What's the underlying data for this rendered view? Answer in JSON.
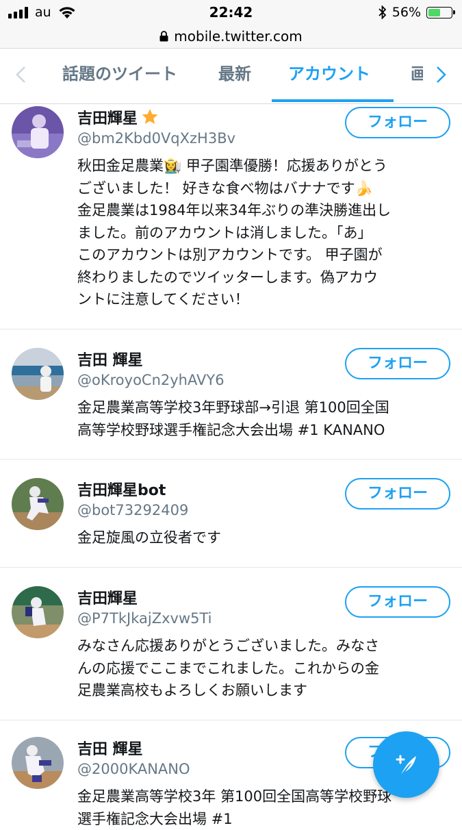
{
  "status_bar": {
    "carrier": "au",
    "time": "22:42",
    "battery_percent": "56%",
    "battery_level": 0.56
  },
  "address_bar": {
    "url": "mobile.twitter.com"
  },
  "tabs": {
    "items": [
      {
        "label": "話題のツイート"
      },
      {
        "label": "最新"
      },
      {
        "label": "アカウント",
        "active": true
      },
      {
        "label": "画像"
      }
    ]
  },
  "accounts": [
    {
      "name": "吉田輝星",
      "handle": "@bm2Kbd0VqXzH3Bv",
      "follow_label": "フォロー",
      "bio": [
        "秋田金足農業👩‍🌾 甲子園準優勝！応援ありがとう",
        "ございました！ 好きな食べ物はバナナです🍌",
        "金足農業は1984年以来34年ぶりの準決勝進出し",
        "ました。前のアカウントは消しました。「あ」",
        "このアカウントは別アカウントです。 甲子園が",
        "終わりましたのでツイッターします。偽アカウ",
        "ントに注意してください！"
      ]
    },
    {
      "name": "吉田 輝星",
      "handle": "@oKroyoCn2yhAVY6",
      "follow_label": "フォロー",
      "bio": [
        "金足農業高等学校3年野球部→引退 第100回全国",
        "高等学校野球選手権記念大会出場 #1 KANANO"
      ]
    },
    {
      "name": "吉田輝星bot",
      "handle": "@bot73292409",
      "follow_label": "フォロー",
      "bio": [
        "金足旋風の立役者です"
      ]
    },
    {
      "name": "吉田輝星",
      "handle": "@P7TkJkajZxvw5Ti",
      "follow_label": "フォロー",
      "bio": [
        "みなさん応援ありがとうございました。みなさ",
        "んの応援でここまでこれました。これからの金",
        "足農業高校もよろしくお願いします"
      ]
    },
    {
      "name": "吉田 輝星",
      "handle": "@2000KANANO",
      "follow_label": "フォロー",
      "bio": [
        "金足農業高等学校3年 第100回全国高等学校野球",
        "選手権記念大会出場 #1"
      ]
    }
  ],
  "colors": {
    "accent": "#1da1f2",
    "secondary_text": "#657786",
    "divider": "#e1e8ed"
  },
  "icons": [
    "signal-icon",
    "wifi-icon",
    "bluetooth-icon",
    "lock-icon",
    "chevron-left-icon",
    "chevron-right-icon",
    "star-icon",
    "compose-tweet-icon"
  ]
}
